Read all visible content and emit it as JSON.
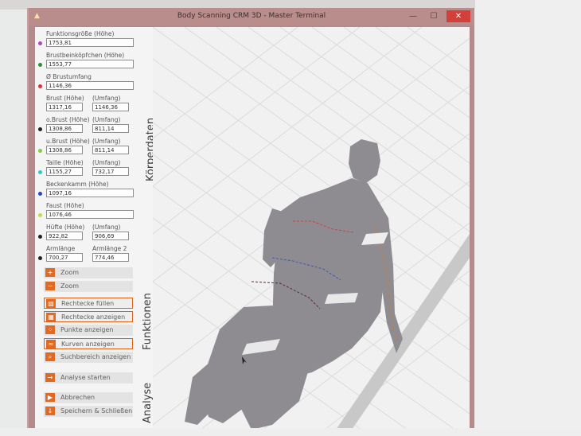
{
  "window": {
    "title": "Body Scanning CRM 3D - Master Terminal",
    "min_glyph": "—",
    "max_glyph": "☐",
    "close_glyph": "✕"
  },
  "sections": {
    "koerperdaten": "Körperdaten",
    "funktionen": "Funktionen",
    "analyse": "Analyse"
  },
  "fields": [
    {
      "label": "Funktionsgröße (Höhe)",
      "value": "1753,81",
      "dot": "#b04ab3"
    },
    {
      "label": "Brustbeinköpfchen (Höhe)",
      "value": "1553,77",
      "dot": "#2c8f3c"
    },
    {
      "label": "Ø Brustumfang",
      "value": "1146,36",
      "dot": "#d8343a"
    },
    {
      "label": "Brust (Höhe)",
      "value": "1317,16",
      "label2": "(Umfang)",
      "value2": "1146,36"
    },
    {
      "label": "o.Brust (Höhe)",
      "value": "1308,86",
      "label2": "(Umfang)",
      "value2": "811,14",
      "dot": "#222222"
    },
    {
      "label": "u.Brust (Höhe)",
      "value": "1308,86",
      "label2": "(Umfang)",
      "value2": "811,14",
      "dot": "#86cc3c"
    },
    {
      "label": "Taille (Höhe)",
      "value": "1155,27",
      "label2": "(Umfang)",
      "value2": "732,17",
      "dot": "#39c7c5"
    },
    {
      "label": "Beckenkamm (Höhe)",
      "value": "1097,16",
      "dot": "#2546c5"
    },
    {
      "label": "Faust (Höhe)",
      "value": "1076,46",
      "dot": "#c8d94f"
    },
    {
      "label": "Hüfte (Höhe)",
      "value": "922,82",
      "label2": "(Umfang)",
      "value2": "906,69",
      "dot": "#222222"
    },
    {
      "label": "Armlänge",
      "value": "700,27",
      "label2": "Armlänge 2",
      "value2": "774,46",
      "dot": "#222222"
    }
  ],
  "buttons": [
    {
      "label": "Zoom",
      "icon": "zoom-in-icon",
      "glyph": "+",
      "highlighted": false
    },
    {
      "label": "Zoom",
      "icon": "zoom-out-icon",
      "glyph": "−",
      "highlighted": false
    },
    {
      "label": "Rechtecke füllen",
      "icon": "fill-rect-icon",
      "glyph": "▧",
      "highlighted": true
    },
    {
      "label": "Rechtecke anzeigen",
      "icon": "show-rect-icon",
      "glyph": "▦",
      "highlighted": true
    },
    {
      "label": "Punkte anzeigen",
      "icon": "points-icon",
      "glyph": "⁘",
      "highlighted": false
    },
    {
      "label": "Kurven anzeigen",
      "icon": "curves-icon",
      "glyph": "≈",
      "highlighted": true
    },
    {
      "label": "Suchbereich anzeigen",
      "icon": "search-area-icon",
      "glyph": "⌕",
      "highlighted": false
    },
    {
      "label": "Analyse starten",
      "icon": "arrow-right-icon",
      "glyph": "→",
      "highlighted": false
    },
    {
      "label": "Abbrechen",
      "icon": "play-icon",
      "glyph": "▶",
      "highlighted": false
    },
    {
      "label": "Speichern & Schließen",
      "icon": "download-icon",
      "glyph": "↓",
      "highlighted": false
    }
  ],
  "colors": {
    "accent": "#e06a24",
    "titlebar": "#b98d8c",
    "close": "#d3403a"
  }
}
